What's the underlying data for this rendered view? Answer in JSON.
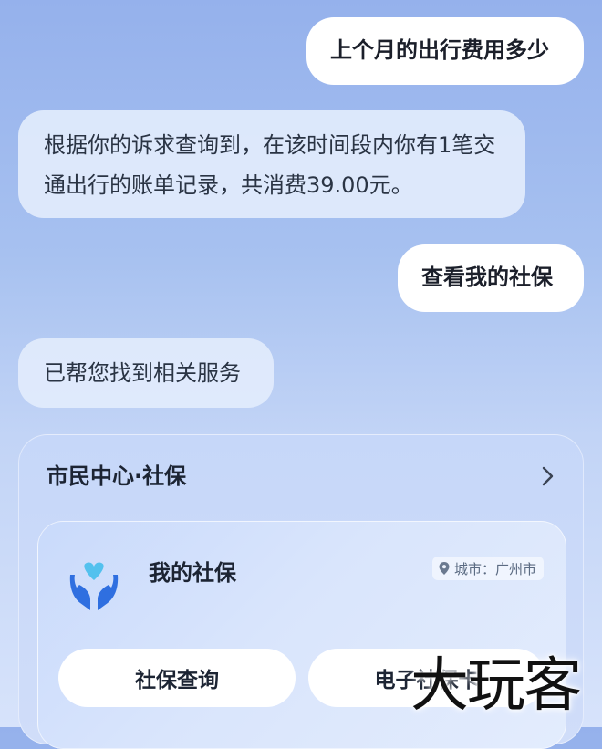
{
  "chat": {
    "messages": [
      {
        "role": "user",
        "text": "上个月的出行费用多少"
      },
      {
        "role": "assistant",
        "text": "根据你的诉求查询到，在该时间段内你有1笔交通出行的账单记录，共消费39.00元。"
      },
      {
        "role": "user",
        "text": "查看我的社保"
      },
      {
        "role": "assistant",
        "text": "已帮您找到相关服务"
      }
    ]
  },
  "service_card": {
    "title": "市民中心·社保",
    "chevron_icon": "chevron-right-icon",
    "app": {
      "icon": "heart-hands-icon",
      "name": "我的社保",
      "city_label": "城市：广州市",
      "city_icon": "location-pin-icon"
    },
    "actions": [
      {
        "label": "社保查询"
      },
      {
        "label": "电子社保卡"
      }
    ]
  },
  "watermark": {
    "text": "大玩客"
  },
  "colors": {
    "icon_blue": "#2f6fe0",
    "icon_heart": "#53c1ee",
    "user_bubble": "#ffffff",
    "assistant_bubble": "#e2ebfc"
  }
}
